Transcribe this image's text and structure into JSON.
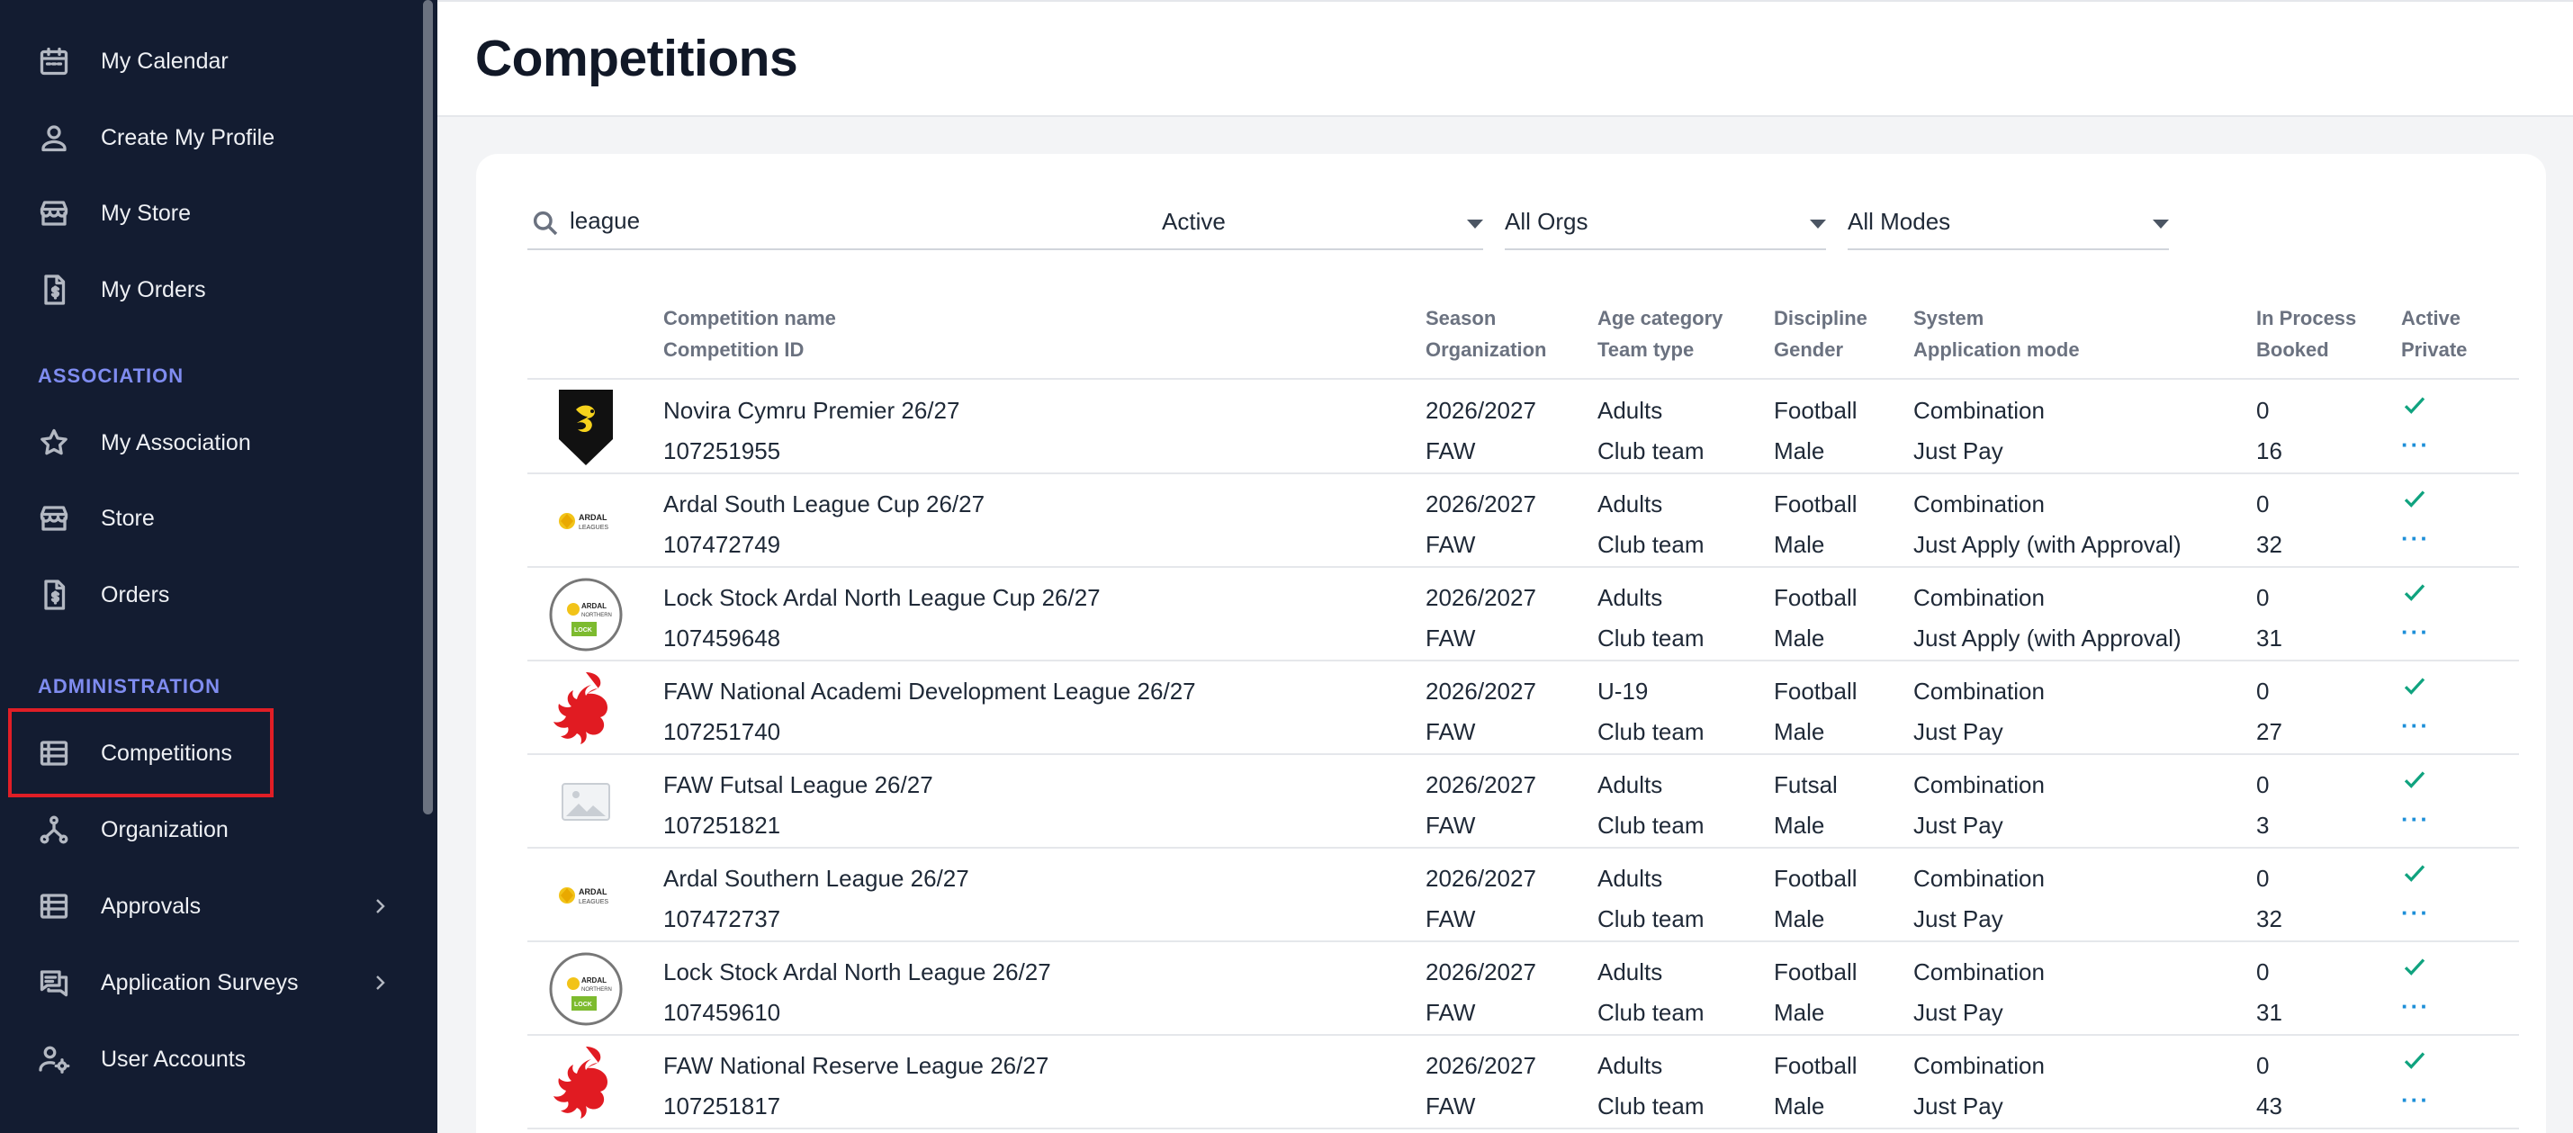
{
  "sidebar": {
    "items_top": [
      {
        "label": "My Calendar",
        "icon": "calendar-icon"
      },
      {
        "label": "Create My Profile",
        "icon": "person-icon"
      },
      {
        "label": "My Store",
        "icon": "store-icon"
      },
      {
        "label": "My Orders",
        "icon": "invoice-icon"
      }
    ],
    "section_association": "ASSOCIATION",
    "items_association": [
      {
        "label": "My Association",
        "icon": "star-icon"
      },
      {
        "label": "Store",
        "icon": "store-icon"
      },
      {
        "label": "Orders",
        "icon": "invoice-icon"
      }
    ],
    "section_administration": "ADMINISTRATION",
    "items_administration": [
      {
        "label": "Competitions",
        "icon": "list-icon"
      },
      {
        "label": "Organization",
        "icon": "hierarchy-icon"
      },
      {
        "label": "Approvals",
        "icon": "list-icon"
      },
      {
        "label": "Application Surveys",
        "icon": "chat-icon"
      },
      {
        "label": "User Accounts",
        "icon": "user-gear-icon"
      }
    ]
  },
  "header": {
    "title": "Competitions"
  },
  "filters": {
    "search_value": "league",
    "status": "Active",
    "orgs": "All Orgs",
    "modes": "All Modes"
  },
  "table": {
    "headers": {
      "name": [
        "Competition name",
        "Competition ID"
      ],
      "season": [
        "Season",
        "Organization"
      ],
      "age": [
        "Age category",
        "Team type"
      ],
      "discipline": [
        "Discipline",
        "Gender"
      ],
      "system": [
        "System",
        "Application mode"
      ],
      "process": [
        "In Process",
        "Booked"
      ],
      "active": [
        "Active",
        "Private"
      ]
    },
    "rows": [
      {
        "logo": "dragon-shield-logo",
        "name": "Novira Cymru Premier 26/27",
        "id": "107251955",
        "season": "2026/2027",
        "org": "FAW",
        "age": "Adults",
        "team": "Club team",
        "discipline": "Football",
        "gender": "Male",
        "system": "Combination",
        "mode": "Just Pay",
        "in_process": "0",
        "booked": "16"
      },
      {
        "logo": "ardal-leagues-logo",
        "name": "Ardal South League Cup 26/27",
        "id": "107472749",
        "season": "2026/2027",
        "org": "FAW",
        "age": "Adults",
        "team": "Club team",
        "discipline": "Football",
        "gender": "Male",
        "system": "Combination",
        "mode": "Just Apply (with Approval)",
        "in_process": "0",
        "booked": "32"
      },
      {
        "logo": "lock-stock-ardal-logo",
        "name": "Lock Stock Ardal North League Cup 26/27",
        "id": "107459648",
        "season": "2026/2027",
        "org": "FAW",
        "age": "Adults",
        "team": "Club team",
        "discipline": "Football",
        "gender": "Male",
        "system": "Combination",
        "mode": "Just Apply (with Approval)",
        "in_process": "0",
        "booked": "31"
      },
      {
        "logo": "red-dragon-logo",
        "name": "FAW National Academi Development League 26/27",
        "id": "107251740",
        "season": "2026/2027",
        "org": "FAW",
        "age": "U-19",
        "team": "Club team",
        "discipline": "Football",
        "gender": "Male",
        "system": "Combination",
        "mode": "Just Pay",
        "in_process": "0",
        "booked": "27"
      },
      {
        "logo": "image-placeholder-logo",
        "name": "FAW Futsal League 26/27",
        "id": "107251821",
        "season": "2026/2027",
        "org": "FAW",
        "age": "Adults",
        "team": "Club team",
        "discipline": "Futsal",
        "gender": "Male",
        "system": "Combination",
        "mode": "Just Pay",
        "in_process": "0",
        "booked": "3"
      },
      {
        "logo": "ardal-leagues-logo",
        "name": "Ardal Southern League 26/27",
        "id": "107472737",
        "season": "2026/2027",
        "org": "FAW",
        "age": "Adults",
        "team": "Club team",
        "discipline": "Football",
        "gender": "Male",
        "system": "Combination",
        "mode": "Just Pay",
        "in_process": "0",
        "booked": "32"
      },
      {
        "logo": "lock-stock-ardal-logo",
        "name": "Lock Stock Ardal North League 26/27",
        "id": "107459610",
        "season": "2026/2027",
        "org": "FAW",
        "age": "Adults",
        "team": "Club team",
        "discipline": "Football",
        "gender": "Male",
        "system": "Combination",
        "mode": "Just Pay",
        "in_process": "0",
        "booked": "31"
      },
      {
        "logo": "red-dragon-logo",
        "name": "FAW National Reserve League 26/27",
        "id": "107251817",
        "season": "2026/2027",
        "org": "FAW",
        "age": "Adults",
        "team": "Club team",
        "discipline": "Football",
        "gender": "Male",
        "system": "Combination",
        "mode": "Just Pay",
        "in_process": "0",
        "booked": "43"
      }
    ]
  },
  "colors": {
    "sidebar_bg": "#131c31",
    "section": "#7f8cf0",
    "highlight": "#e01e26",
    "check": "#10a37f",
    "dots": "#1d8fd8"
  }
}
